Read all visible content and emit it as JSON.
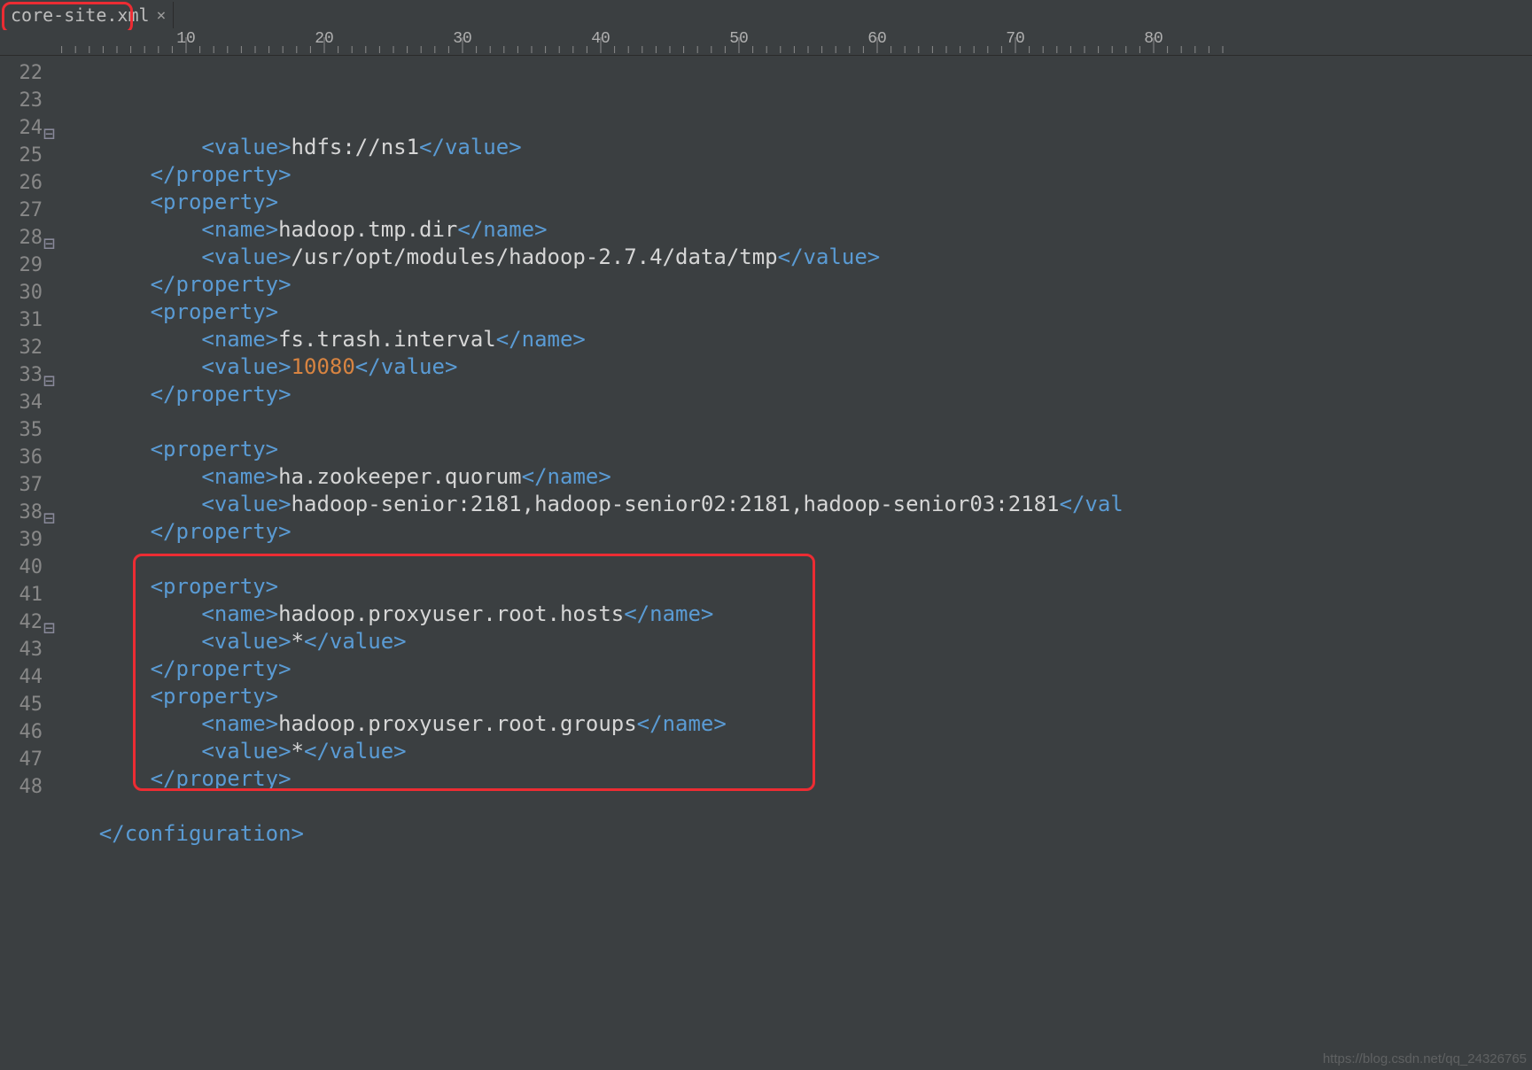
{
  "tab": {
    "filename": "core-site.xml",
    "close_glyph": "×"
  },
  "ruler_labels": [
    "10",
    "20",
    "30",
    "40",
    "50",
    "60",
    "70",
    "80"
  ],
  "gutter": {
    "start": 22,
    "end": 48,
    "foldable": [
      24,
      28,
      33,
      38,
      42
    ]
  },
  "code": {
    "lines": [
      {
        "n": 22,
        "indent": 3,
        "seg": [
          {
            "c": "tag",
            "t": "<value>"
          },
          {
            "c": "txt",
            "t": "hdfs://ns1"
          },
          {
            "c": "tag",
            "t": "</value>"
          }
        ]
      },
      {
        "n": 23,
        "indent": 2,
        "seg": [
          {
            "c": "tag",
            "t": "</property>"
          }
        ]
      },
      {
        "n": 24,
        "indent": 2,
        "seg": [
          {
            "c": "tag",
            "t": "<property>"
          }
        ]
      },
      {
        "n": 25,
        "indent": 3,
        "seg": [
          {
            "c": "tag",
            "t": "<name>"
          },
          {
            "c": "txt",
            "t": "hadoop.tmp.dir"
          },
          {
            "c": "tag",
            "t": "</name>"
          }
        ]
      },
      {
        "n": 26,
        "indent": 3,
        "seg": [
          {
            "c": "tag",
            "t": "<value>"
          },
          {
            "c": "txt",
            "t": "/usr/opt/modules/hadoop-2.7.4/data/tmp"
          },
          {
            "c": "tag",
            "t": "</value>"
          }
        ]
      },
      {
        "n": 27,
        "indent": 2,
        "seg": [
          {
            "c": "tag",
            "t": "</property>"
          }
        ]
      },
      {
        "n": 28,
        "indent": 2,
        "seg": [
          {
            "c": "tag",
            "t": "<property>"
          }
        ]
      },
      {
        "n": 29,
        "indent": 3,
        "seg": [
          {
            "c": "tag",
            "t": "<name>"
          },
          {
            "c": "txt",
            "t": "fs.trash.interval"
          },
          {
            "c": "tag",
            "t": "</name>"
          }
        ]
      },
      {
        "n": 30,
        "indent": 3,
        "seg": [
          {
            "c": "tag",
            "t": "<value>"
          },
          {
            "c": "num",
            "t": "10080"
          },
          {
            "c": "tag",
            "t": "</value>"
          }
        ]
      },
      {
        "n": 31,
        "indent": 2,
        "seg": [
          {
            "c": "tag",
            "t": "</property>"
          }
        ]
      },
      {
        "n": 32,
        "indent": 0,
        "seg": []
      },
      {
        "n": 33,
        "indent": 2,
        "seg": [
          {
            "c": "tag",
            "t": "<property>"
          }
        ]
      },
      {
        "n": 34,
        "indent": 3,
        "seg": [
          {
            "c": "tag",
            "t": "<name>"
          },
          {
            "c": "txt",
            "t": "ha.zookeeper.quorum"
          },
          {
            "c": "tag",
            "t": "</name>"
          }
        ]
      },
      {
        "n": 35,
        "indent": 3,
        "seg": [
          {
            "c": "tag",
            "t": "<value>"
          },
          {
            "c": "txt",
            "t": "hadoop-senior:2181,hadoop-senior02:2181,hadoop-senior03:2181"
          },
          {
            "c": "tag",
            "t": "</val"
          }
        ]
      },
      {
        "n": 36,
        "indent": 2,
        "seg": [
          {
            "c": "tag",
            "t": "</property>"
          }
        ]
      },
      {
        "n": 37,
        "indent": 0,
        "seg": []
      },
      {
        "n": 38,
        "indent": 2,
        "seg": [
          {
            "c": "tag",
            "t": "<property>"
          }
        ]
      },
      {
        "n": 39,
        "indent": 3,
        "seg": [
          {
            "c": "tag",
            "t": "<name>"
          },
          {
            "c": "txt",
            "t": "hadoop.proxyuser.root.hosts"
          },
          {
            "c": "tag",
            "t": "</name>"
          }
        ]
      },
      {
        "n": 40,
        "indent": 3,
        "seg": [
          {
            "c": "tag",
            "t": "<value>"
          },
          {
            "c": "txt",
            "t": "*"
          },
          {
            "c": "tag",
            "t": "</value>"
          }
        ]
      },
      {
        "n": 41,
        "indent": 2,
        "seg": [
          {
            "c": "tag",
            "t": "</property>"
          }
        ]
      },
      {
        "n": 42,
        "indent": 2,
        "seg": [
          {
            "c": "tag",
            "t": "<property>"
          }
        ]
      },
      {
        "n": 43,
        "indent": 3,
        "seg": [
          {
            "c": "tag",
            "t": "<name>"
          },
          {
            "c": "txt",
            "t": "hadoop.proxyuser.root.groups"
          },
          {
            "c": "tag",
            "t": "</name>"
          }
        ]
      },
      {
        "n": 44,
        "indent": 3,
        "seg": [
          {
            "c": "tag",
            "t": "<value>"
          },
          {
            "c": "txt",
            "t": "*"
          },
          {
            "c": "tag",
            "t": "</value>"
          }
        ]
      },
      {
        "n": 45,
        "indent": 2,
        "seg": [
          {
            "c": "tag",
            "t": "</property>"
          }
        ]
      },
      {
        "n": 46,
        "indent": 0,
        "seg": []
      },
      {
        "n": 47,
        "indent": 1,
        "seg": [
          {
            "c": "tag",
            "t": "</configuration>"
          }
        ]
      },
      {
        "n": 48,
        "indent": 0,
        "seg": []
      }
    ]
  },
  "highlights": {
    "tab_box": true,
    "block_box": {
      "from_line": 38,
      "to_line": 45
    }
  },
  "watermark": "https://blog.csdn.net/qq_24326765"
}
